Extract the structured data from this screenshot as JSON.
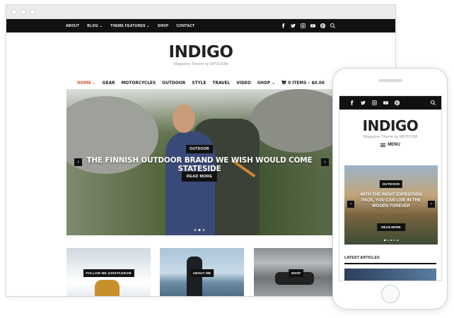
{
  "desktop": {
    "topnav": [
      "ABOUT",
      "BLOG ⌄",
      "THEME FEATURES ⌄",
      "SHOP",
      "CONTACT"
    ],
    "social_icons": [
      "facebook-icon",
      "twitter-icon",
      "instagram-icon",
      "youtube-icon",
      "pinterest-icon",
      "search-icon"
    ],
    "logo": "INDIGO",
    "tagline": "Magazine Theme by WPZOOM",
    "mainnav": [
      "HOME ⌄",
      "GEAR",
      "MOTORCYCLES",
      "OUTDOOR",
      "STYLE",
      "TRAVEL",
      "VIDEO",
      "SHOP ⌄"
    ],
    "cart_label": "0 ITEMS – $0.00",
    "hero": {
      "badge": "OUTDOOR",
      "title": "THE FINNISH OUTDOOR BRAND WE WISH WOULD COME STATESIDE",
      "button": "READ MORE"
    },
    "tiles": [
      "FOLLOW ME @INSTAGRAM",
      "ABOUT ME",
      "SHOP"
    ]
  },
  "phone": {
    "logo": "INDIGO",
    "tagline": "Magazine Theme by WPZOOM",
    "menu_label": "MENU",
    "hero": {
      "badge": "OUTDOOR",
      "title": "WITH THE RIGHT EXPEDITION PACK, YOU CAN LIVE IN THE WOODS FOREVER",
      "button": "READ MORE"
    },
    "latest_label": "LATEST ARTICLES"
  },
  "colors": {
    "accent": "#d9532b",
    "dark": "#111111"
  }
}
